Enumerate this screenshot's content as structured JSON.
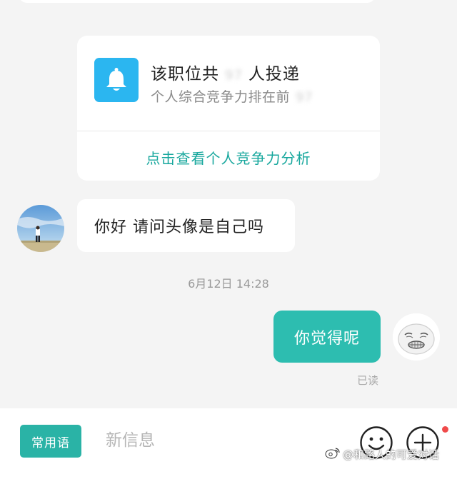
{
  "notification": {
    "title_prefix": "该职位共",
    "title_number": "97",
    "title_suffix": "人投递",
    "subtitle_prefix": "个人综合竞争力排在前",
    "subtitle_number": "97",
    "link_label": "点击查看个人竞争力分析",
    "icon": "bell-icon"
  },
  "messages": {
    "incoming_text": "你好 请问头像是自己吗",
    "timestamp": "6月12日 14:28",
    "outgoing_text": "你觉得呢",
    "read_status": "已读"
  },
  "input_bar": {
    "phrases_label": "常用语",
    "placeholder": "新信息",
    "emoji_icon": "smiley-icon",
    "plus_icon": "plus-icon"
  },
  "watermark": {
    "text": "@和路人的可爱对话",
    "icon": "weibo-icon"
  },
  "colors": {
    "accent_teal": "#2dbdb0",
    "bell_blue": "#2bb6f0",
    "link_teal": "#17a79d",
    "notification_dot": "#f04a4a"
  }
}
